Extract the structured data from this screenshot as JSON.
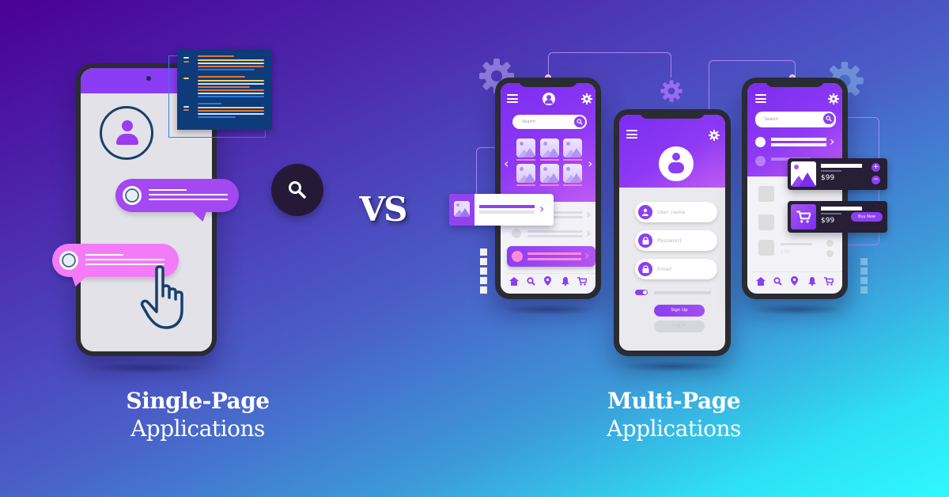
{
  "colors": {
    "bg_top_left": "#4a0096",
    "bg_mid": "#4a5ec8",
    "bg_bottom_right": "#2ef8ff",
    "accent_purple": "#8b3ff0",
    "accent_pink": "#f37bf8",
    "dark_card": "#261f35"
  },
  "vs_label": "VS",
  "spa": {
    "caption_bold": "Single-Page",
    "caption_light": "Applications",
    "icons": [
      "avatar-icon",
      "search-icon",
      "pointer-hand-icon",
      "code-window-icon"
    ]
  },
  "mpa": {
    "caption_bold": "Multi-Page",
    "caption_light": "Applications",
    "phone_gallery": {
      "search_placeholder": "Search",
      "nav_icons": [
        "home-icon",
        "search-icon",
        "location-icon",
        "bell-icon",
        "cart-icon"
      ]
    },
    "phone_login": {
      "fields": [
        {
          "placeholder": "User name",
          "icon": "user-icon"
        },
        {
          "placeholder": "Password",
          "icon": "lock-icon"
        },
        {
          "placeholder": "Email",
          "icon": "lock-icon"
        }
      ],
      "sign_up_label": "Sign Up",
      "log_in_label": "Log In"
    },
    "phone_shop": {
      "search_placeholder": "Search",
      "product_cards": [
        {
          "price": "$99",
          "thumb": "image-icon",
          "actions": [
            "+",
            "−"
          ]
        },
        {
          "price": "$99",
          "thumb": "cart-icon",
          "button_label": "Buy Now"
        }
      ],
      "list_price": "$99",
      "nav_icons": [
        "home-icon",
        "search-icon",
        "location-icon",
        "bell-icon",
        "cart-icon"
      ]
    }
  }
}
